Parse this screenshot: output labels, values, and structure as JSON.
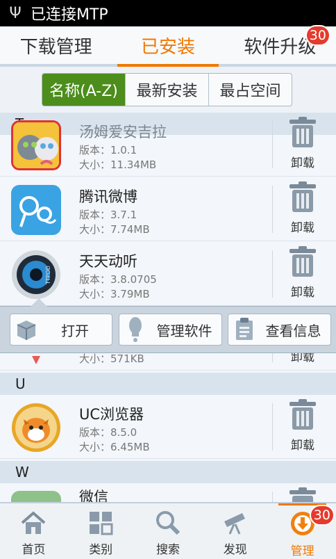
{
  "status_bar": {
    "text": "已连接MTP"
  },
  "tabs": [
    {
      "label": "下载管理"
    },
    {
      "label": "已安装"
    },
    {
      "label": "软件升级",
      "badge": "30"
    }
  ],
  "segments": [
    {
      "label": "名称(A-Z)"
    },
    {
      "label": "最新安装"
    },
    {
      "label": "最占空间"
    }
  ],
  "uninstall_label": "卸载",
  "sections": {
    "t": "T",
    "u": "U",
    "w": "W"
  },
  "apps": {
    "tom": {
      "name": "汤姆爱安吉拉",
      "version": "版本：1.0.1",
      "size": "大小：11.34MB"
    },
    "weibo": {
      "name": "腾讯微博",
      "version": "版本：3.7.1",
      "size": "大小：7.74MB"
    },
    "ttpod": {
      "name": "天天动听",
      "version": "版本：3.8.0705",
      "size": "大小：3.79MB",
      "icon_text": "TTPOD"
    },
    "hidden": {
      "size": "大小：571KB"
    },
    "uc": {
      "name": "UC浏览器",
      "version": "版本：8.5.0",
      "size": "大小：6.45MB"
    },
    "wechat": {
      "name": "微信"
    }
  },
  "popup": [
    {
      "label": "打开",
      "icon": "box-icon"
    },
    {
      "label": "管理软件",
      "icon": "exclamation-icon"
    },
    {
      "label": "查看信息",
      "icon": "document-icon"
    }
  ],
  "bottom_nav": [
    {
      "label": "首页",
      "icon": "home-icon"
    },
    {
      "label": "类别",
      "icon": "grid-icon"
    },
    {
      "label": "搜索",
      "icon": "search-icon"
    },
    {
      "label": "发现",
      "icon": "telescope-icon"
    },
    {
      "label": "管理",
      "icon": "download-circle-icon",
      "badge": "30"
    }
  ],
  "colors": {
    "accent": "#f07800",
    "segment_active": "#4c8d1c",
    "badge": "#e53a2c"
  }
}
